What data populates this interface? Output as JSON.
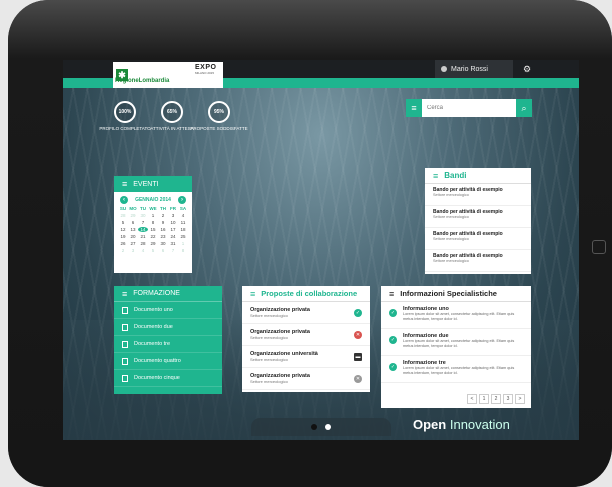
{
  "header": {
    "logo_region": "RegioneLombardia",
    "logo_expo": "EXPO",
    "logo_expo_sub": "MILANO 2015",
    "user_name": "Mario Rossi"
  },
  "stats": [
    {
      "value": "100%",
      "label": "PROFILO COMPLETATO"
    },
    {
      "value": "65%",
      "label": "ATTIVITÀ IN ATTESA"
    },
    {
      "value": "95%",
      "label": "PROPOSTE SODDISFATTE"
    }
  ],
  "search": {
    "placeholder": "Cerca"
  },
  "eventi": {
    "title": "EVENTI",
    "month": "GENNAIO 2014",
    "day_headers": [
      "SU",
      "MO",
      "TU",
      "WE",
      "TH",
      "FR",
      "SA"
    ],
    "rows": [
      [
        "28",
        "29",
        "30",
        "1",
        "2",
        "3",
        "4"
      ],
      [
        "5",
        "6",
        "7",
        "8",
        "9",
        "10",
        "11"
      ],
      [
        "12",
        "13",
        "14",
        "15",
        "16",
        "17",
        "18"
      ],
      [
        "19",
        "20",
        "21",
        "22",
        "23",
        "24",
        "25"
      ],
      [
        "26",
        "27",
        "28",
        "29",
        "30",
        "31",
        "1"
      ],
      [
        "2",
        "3",
        "4",
        "5",
        "6",
        "7",
        "8"
      ]
    ],
    "today": "14"
  },
  "formazione": {
    "title": "FORMAZIONE",
    "items": [
      "Documento uno",
      "Documento due",
      "Documento tre",
      "Documento quattro",
      "Documento cinque"
    ]
  },
  "proposte": {
    "title": "Proposte di collaborazione",
    "items": [
      {
        "title": "Organizzazione privata",
        "sub": "Settore merceologico",
        "status": "ok",
        "color": "#1fb58f"
      },
      {
        "title": "Organizzazione privata",
        "sub": "Settore merceologico",
        "status": "ko",
        "color": "#d9534f"
      },
      {
        "title": "Organizzazione università",
        "sub": "Settore merceologico",
        "status": "msg",
        "color": "#333333"
      },
      {
        "title": "Organizzazione privata",
        "sub": "Settore merceologico",
        "status": "pending",
        "color": "#999999"
      }
    ]
  },
  "info": {
    "title": "Informazioni Specialistiche",
    "items": [
      {
        "title": "Informazione uno",
        "body": "Lorem ipsum dolor sit amet, consectetur adipiscing elit. Etiam quis metus interdum, tempor dolor id."
      },
      {
        "title": "Informazione due",
        "body": "Lorem ipsum dolor sit amet, consectetur adipiscing elit. Etiam quis metus interdum, tempor dolor id."
      },
      {
        "title": "Informazione tre",
        "body": "Lorem ipsum dolor sit amet, consectetur adipiscing elit. Etiam quis metus interdum, tempor dolor id."
      }
    ],
    "pager": [
      "<",
      "1",
      "2",
      "3",
      ">"
    ]
  },
  "bandi": {
    "title": "Bandi",
    "items": [
      {
        "title": "Bando per attività di esempio",
        "sub": "Settore merceologico"
      },
      {
        "title": "Bando per attività di esempio",
        "sub": "Settore merceologico"
      },
      {
        "title": "Bando per attività di esempio",
        "sub": "Settore merceologico"
      },
      {
        "title": "Bando per attività di esempio",
        "sub": "Settore merceologico"
      }
    ]
  },
  "footer": {
    "brand_strong": "Open",
    "brand_light": " Innovation"
  },
  "colors": {
    "accent": "#1fb58f"
  }
}
